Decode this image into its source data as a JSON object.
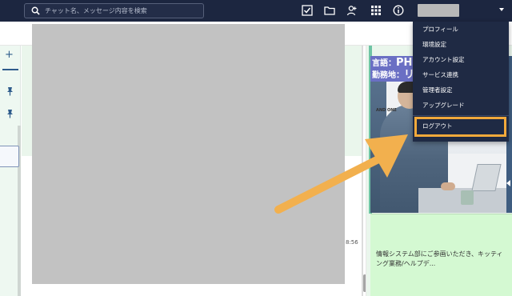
{
  "search": {
    "placeholder": "チャット名、メッセージ内容を検索"
  },
  "toolbar": {
    "icons": [
      "checkbox-icon",
      "folder-icon",
      "add-contact-icon",
      "grid-icon",
      "info-icon"
    ]
  },
  "user_menu": {
    "items": [
      "プロフィール",
      "環境設定",
      "アカウント設定",
      "サービス連携",
      "管理者設定",
      "アップグレード"
    ],
    "logout": "ログアウト"
  },
  "chat": {
    "time": "8:56"
  },
  "ad": {
    "line1_prefix": "言語：",
    "line1_value": "PHP",
    "line2_prefix": "勤務地：",
    "line2_value": "リモ",
    "logo": "AND ONE"
  },
  "right_panel": {
    "text": "情報システム部にご参画いただき、キッティング業務/ヘルプデ..."
  },
  "colors": {
    "topbar": "#1c2640",
    "highlight": "#f2a93b",
    "chat_bg": "#eaf6ec"
  }
}
